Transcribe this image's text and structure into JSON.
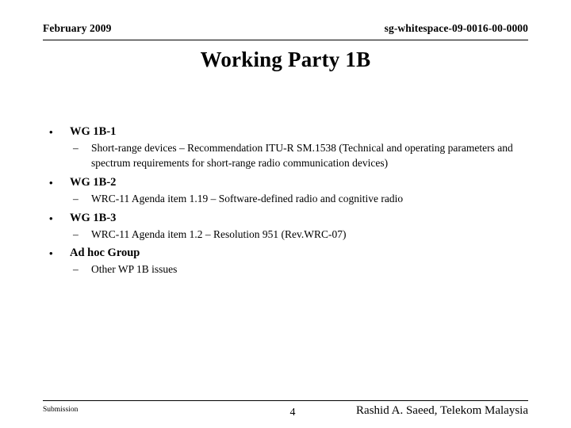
{
  "header": {
    "date": "February 2009",
    "doc_id": "sg-whitespace-09-0016-00-0000"
  },
  "title": "Working Party 1B",
  "bullet_marker": "•",
  "dash_marker": "–",
  "groups": [
    {
      "heading": "WG 1B-1",
      "items": [
        "Short-range devices – Recommendation ITU-R SM.1538 (Technical and operating parameters and spectrum requirements for short-range radio communication devices)"
      ]
    },
    {
      "heading": "WG 1B-2",
      "items": [
        "WRC-11 Agenda item 1.19 – Software-defined radio and cognitive radio"
      ]
    },
    {
      "heading": "WG 1B-3",
      "items": [
        "WRC-11 Agenda item 1.2 – Resolution 951 (Rev.WRC-07)"
      ]
    },
    {
      "heading": "Ad hoc Group",
      "items": [
        "Other WP 1B issues"
      ]
    }
  ],
  "footer": {
    "submission": "Submission",
    "page_number": "4",
    "author": "Rashid A. Saeed, Telekom Malaysia"
  },
  "colors": {
    "text": "#000000",
    "background": "#ffffff",
    "rule": "#000000"
  }
}
